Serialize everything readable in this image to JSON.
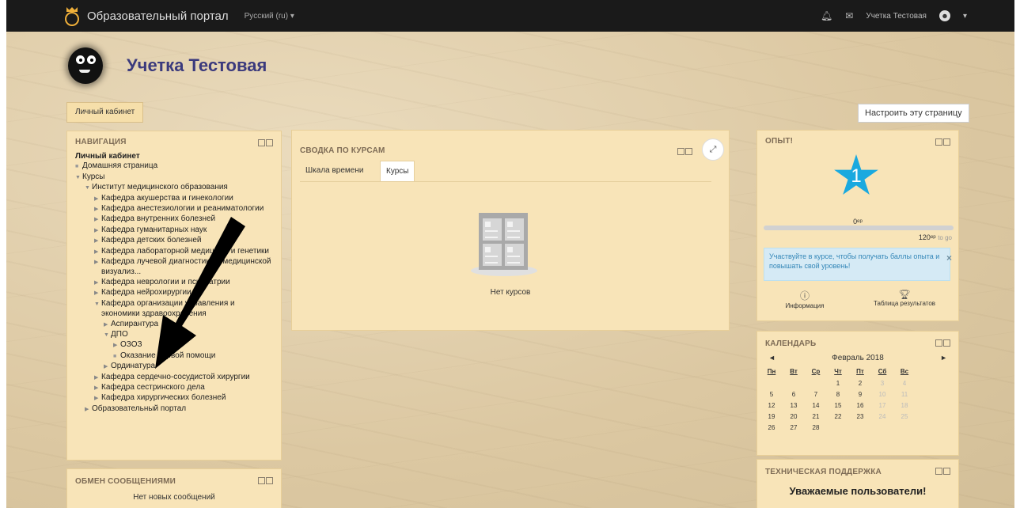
{
  "navbar": {
    "site_name": "Образовательный портал",
    "language": "Русский (ru) ▾",
    "user_name": "Учетка Тестовая",
    "user_caret": "▾"
  },
  "header": {
    "title": "Учетка Тестовая",
    "breadcrumb": "Личный кабинет",
    "customise_button": "Настроить эту страницу"
  },
  "navigation": {
    "title": "НАВИГАЦИЯ",
    "items": [
      {
        "label": "Личный кабинет",
        "level": 0,
        "marker": "",
        "bold": true
      },
      {
        "label": "Домашняя страница",
        "level": 0,
        "marker": "bullet"
      },
      {
        "label": "Курсы",
        "level": 0,
        "marker": "open"
      },
      {
        "label": "Институт медицинского образования",
        "level": 1,
        "marker": "open"
      },
      {
        "label": "Кафедра акушерства и гинекологии",
        "level": 2,
        "marker": "closed"
      },
      {
        "label": "Кафедра анестезиологии и реаниматологии",
        "level": 2,
        "marker": "closed"
      },
      {
        "label": "Кафедра внутренних болезней",
        "level": 2,
        "marker": "closed"
      },
      {
        "label": "Кафедра гуманитарных наук",
        "level": 2,
        "marker": "closed"
      },
      {
        "label": "Кафедра детских болезней",
        "level": 2,
        "marker": "closed"
      },
      {
        "label": "Кафедра лабораторной медицины и генетики",
        "level": 2,
        "marker": "closed"
      },
      {
        "label": "Кафедра лучевой диагностики и медицинской",
        "level": 2,
        "marker": "closed"
      },
      {
        "label": "визуализ...",
        "level": 2,
        "marker": ""
      },
      {
        "label": "Кафедра неврологии и психиатрии",
        "level": 2,
        "marker": "closed"
      },
      {
        "label": "Кафедра нейрохирургии",
        "level": 2,
        "marker": "closed"
      },
      {
        "label": "Кафедра организации управления и",
        "level": 2,
        "marker": "open"
      },
      {
        "label": "экономики здравоохранения",
        "level": 2,
        "marker": ""
      },
      {
        "label": "Аспирантура",
        "level": 3,
        "marker": "closed"
      },
      {
        "label": "ДПО",
        "level": 3,
        "marker": "open"
      },
      {
        "label": "ОЗОЗ",
        "level": 4,
        "marker": "closed"
      },
      {
        "label": "Оказание первой помощи",
        "level": 4,
        "marker": "bullet"
      },
      {
        "label": "Ординатура",
        "level": 3,
        "marker": "closed"
      },
      {
        "label": "Кафедра сердечно-сосудистой хирургии",
        "level": 2,
        "marker": "closed"
      },
      {
        "label": "Кафедра сестринского дела",
        "level": 2,
        "marker": "closed"
      },
      {
        "label": "Кафедра хирургических болезней",
        "level": 2,
        "marker": "closed"
      },
      {
        "label": "Образовательный портал",
        "level": 1,
        "marker": "closed"
      }
    ]
  },
  "messaging": {
    "title": "ОБМЕН СООБЩЕНИЯМИ",
    "empty": "Нет новых сообщений"
  },
  "overview": {
    "title": "СВОДКА ПО КУРСАМ",
    "tabs": [
      "Шкала времени",
      "Курсы"
    ],
    "active_tab": "Курсы",
    "empty": "Нет курсов",
    "expand_icon": "expand-icon"
  },
  "experience": {
    "title": "ОПЫТ!",
    "level": "1",
    "current": "0ᵉᵖ",
    "progress_fraction": 0,
    "next": "120ᵉᵖ",
    "next_suffix": "to go",
    "info_text": "Участвуйте в курсе, чтобы получать баллы опыта и повышать свой уровень!",
    "link_info": "Информация",
    "link_ladder": "Таблица результатов",
    "star_color": "#1aa9df"
  },
  "calendar": {
    "title": "КАЛЕНДАРЬ",
    "month": "Февраль 2018",
    "prev": "◄",
    "next": "►",
    "weekdays": [
      "Пн",
      "Вт",
      "Ср",
      "Чт",
      "Пт",
      "Сб",
      "Вс"
    ],
    "weeks": [
      [
        "",
        "",
        "",
        "1",
        "2",
        "3",
        "4"
      ],
      [
        "5",
        "6",
        "7",
        "8",
        "9",
        "10",
        "11"
      ],
      [
        "12",
        "13",
        "14",
        "15",
        "16",
        "17",
        "18"
      ],
      [
        "19",
        "20",
        "21",
        "22",
        "23",
        "24",
        "25"
      ],
      [
        "26",
        "27",
        "28",
        "",
        "",
        "",
        ""
      ]
    ]
  },
  "support": {
    "title": "ТЕХНИЧЕСКАЯ ПОДДЕРЖКА",
    "text": "Уважаемые пользователи!"
  }
}
